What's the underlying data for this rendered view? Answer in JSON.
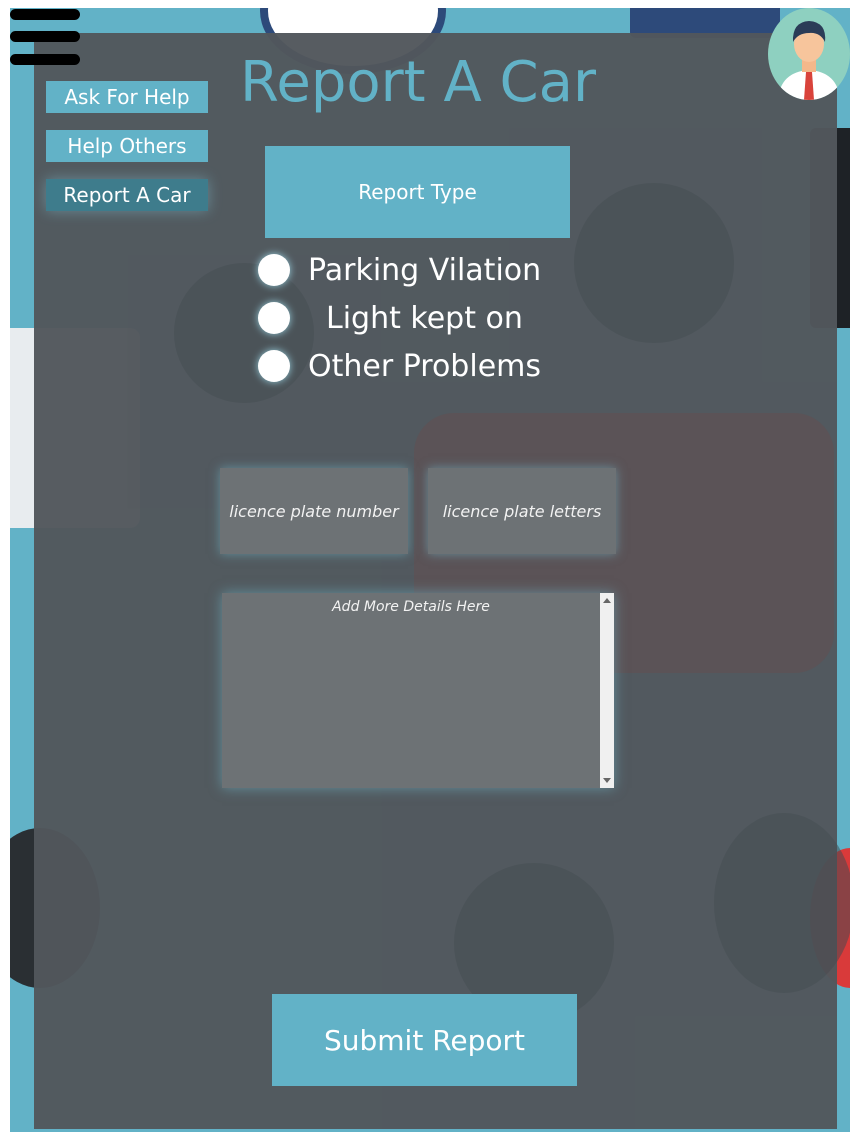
{
  "page": {
    "title": "Report A Car"
  },
  "nav": {
    "items": [
      {
        "label": "Ask For Help",
        "active": false
      },
      {
        "label": "Help Others",
        "active": false
      },
      {
        "label": "Report A Car",
        "active": true
      }
    ]
  },
  "report_type": {
    "label": "Report Type",
    "options": [
      {
        "label": "Parking Vilation",
        "selected": false
      },
      {
        "label": "Light kept on",
        "selected": false
      },
      {
        "label": "Other Problems",
        "selected": false
      }
    ]
  },
  "form": {
    "plate_number_placeholder": "licence plate number",
    "plate_letters_placeholder": "licence plate letters",
    "details_placeholder": "Add More Details Here",
    "submit_label": "Submit Report"
  },
  "icons": {
    "menu": "hamburger-menu-icon",
    "avatar": "user-avatar"
  },
  "colors": {
    "accent": "#62b2c7",
    "accent_active": "#3e7c8c",
    "panel": "#52575c",
    "input_bg": "#6d7275"
  }
}
